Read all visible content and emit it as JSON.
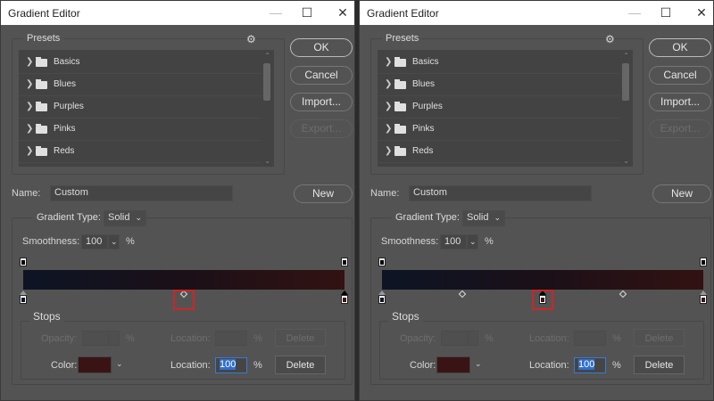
{
  "colors": {
    "accent_highlight": "#d02424",
    "stop_color": "#3a1414",
    "gradient_start": "#0d1424",
    "gradient_end": "#321212"
  },
  "dialogs": [
    {
      "title": "Gradient Editor",
      "minimize": "—",
      "maximize": "☐",
      "close": "✕",
      "presets": {
        "label": "Presets",
        "gear": "⚙",
        "items": [
          "Basics",
          "Blues",
          "Purples",
          "Pinks",
          "Reds"
        ]
      },
      "buttons": {
        "ok": "OK",
        "cancel": "Cancel",
        "import": "Import...",
        "export": "Export...",
        "new": "New"
      },
      "name": {
        "label": "Name:",
        "value": "Custom"
      },
      "gradient_type": {
        "label": "Gradient Type:",
        "value": "Solid"
      },
      "smoothness": {
        "label": "Smoothness:",
        "value": "100",
        "unit": "%"
      },
      "opacity_stops": [
        0,
        100
      ],
      "color_stops": [
        0,
        100
      ],
      "midpoints": [
        50
      ],
      "selected_stop": 100,
      "highlight_midpoint": 50,
      "stops": {
        "label": "Stops",
        "opacity_label": "Opacity:",
        "opacity_unit": "%",
        "location_label": "Location:",
        "location_unit": "%",
        "delete": "Delete",
        "color_label": "Color:",
        "color_location": "100",
        "color_location_unit": "%",
        "color_delete": "Delete"
      }
    },
    {
      "title": "Gradient Editor",
      "minimize": "—",
      "maximize": "☐",
      "close": "✕",
      "presets": {
        "label": "Presets",
        "gear": "⚙",
        "items": [
          "Basics",
          "Blues",
          "Purples",
          "Pinks",
          "Reds"
        ]
      },
      "buttons": {
        "ok": "OK",
        "cancel": "Cancel",
        "import": "Import...",
        "export": "Export...",
        "new": "New"
      },
      "name": {
        "label": "Name:",
        "value": "Custom"
      },
      "gradient_type": {
        "label": "Gradient Type:",
        "value": "Solid"
      },
      "smoothness": {
        "label": "Smoothness:",
        "value": "100",
        "unit": "%"
      },
      "opacity_stops": [
        0,
        100
      ],
      "color_stops": [
        0,
        50,
        100
      ],
      "midpoints": [
        25,
        75
      ],
      "selected_stop": 50,
      "highlight_stop": 50,
      "stops": {
        "label": "Stops",
        "opacity_label": "Opacity:",
        "opacity_unit": "%",
        "location_label": "Location:",
        "location_unit": "%",
        "delete": "Delete",
        "color_label": "Color:",
        "color_location": "100",
        "color_location_unit": "%",
        "color_delete": "Delete"
      }
    }
  ]
}
